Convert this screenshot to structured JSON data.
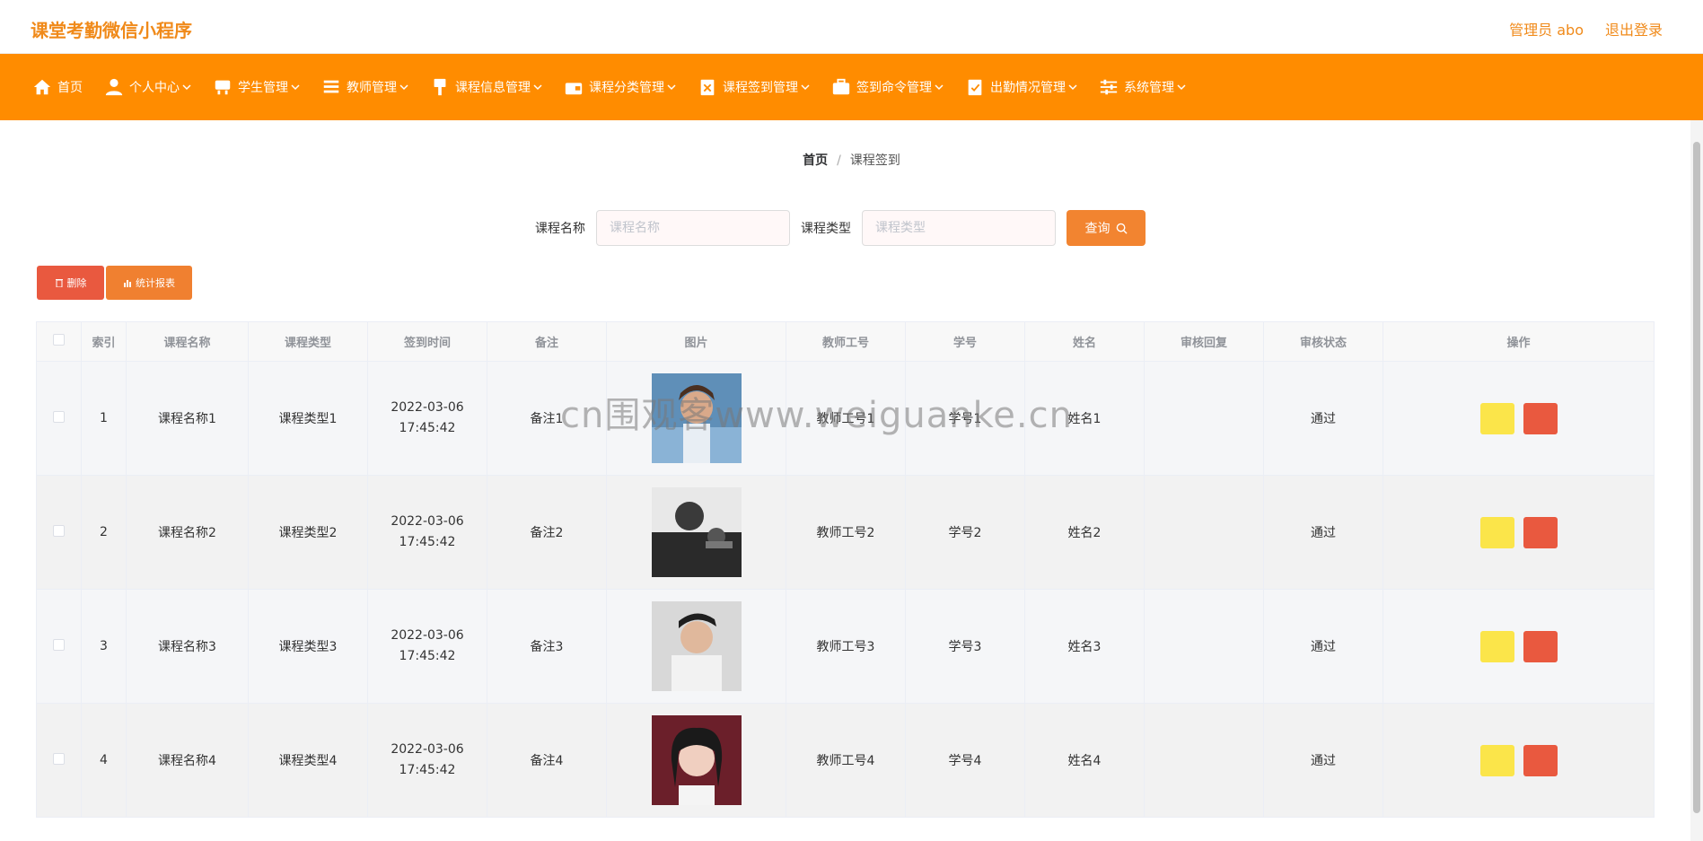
{
  "header": {
    "app_title": "课堂考勤微信小程序",
    "admin_label": "管理员 abo",
    "logout_label": "退出登录"
  },
  "nav": {
    "items": [
      {
        "label": "首页",
        "icon": "home-icon"
      },
      {
        "label": "个人中心",
        "icon": "user-icon"
      },
      {
        "label": "学生管理",
        "icon": "desk-icon"
      },
      {
        "label": "教师管理",
        "icon": "list-icon"
      },
      {
        "label": "课程信息管理",
        "icon": "brush-icon"
      },
      {
        "label": "课程分类管理",
        "icon": "wallet-icon"
      },
      {
        "label": "课程签到管理",
        "icon": "clipboard-x-icon"
      },
      {
        "label": "签到命令管理",
        "icon": "briefcase-icon"
      },
      {
        "label": "出勤情况管理",
        "icon": "clipboard-check-icon"
      },
      {
        "label": "系统管理",
        "icon": "sliders-icon"
      }
    ]
  },
  "breadcrumb": {
    "home": "首页",
    "separator": "/",
    "current": "课程签到"
  },
  "search": {
    "course_name_label": "课程名称",
    "course_name_placeholder": "课程名称",
    "course_type_label": "课程类型",
    "course_type_placeholder": "课程类型",
    "query_label": "查询"
  },
  "actions": {
    "delete_label": "删除",
    "stats_label": "统计报表"
  },
  "table": {
    "headers": [
      "索引",
      "课程名称",
      "课程类型",
      "签到时间",
      "备注",
      "图片",
      "教师工号",
      "学号",
      "姓名",
      "审核回复",
      "审核状态",
      "操作"
    ],
    "rows": [
      {
        "index": "1",
        "course_name": "课程名称1",
        "course_type": "课程类型1",
        "sign_time": "2022-03-06 17:45:42",
        "remark": "备注1",
        "teacher_no": "教师工号1",
        "student_no": "学号1",
        "name": "姓名1",
        "reply": "",
        "status": "通过"
      },
      {
        "index": "2",
        "course_name": "课程名称2",
        "course_type": "课程类型2",
        "sign_time": "2022-03-06 17:45:42",
        "remark": "备注2",
        "teacher_no": "教师工号2",
        "student_no": "学号2",
        "name": "姓名2",
        "reply": "",
        "status": "通过"
      },
      {
        "index": "3",
        "course_name": "课程名称3",
        "course_type": "课程类型3",
        "sign_time": "2022-03-06 17:45:42",
        "remark": "备注3",
        "teacher_no": "教师工号3",
        "student_no": "学号3",
        "name": "姓名3",
        "reply": "",
        "status": "通过"
      },
      {
        "index": "4",
        "course_name": "课程名称4",
        "course_type": "课程类型4",
        "sign_time": "2022-03-06 17:45:42",
        "remark": "备注4",
        "teacher_no": "教师工号4",
        "student_no": "学号4",
        "name": "姓名4",
        "reply": "",
        "status": "通过"
      }
    ]
  },
  "watermark": "cn围观客www.weiguanke.cn",
  "colors": {
    "brand_orange": "#ff8c00",
    "query_button": "#f28430",
    "delete_red": "#e9593f",
    "edit_yellow": "#fbe54a"
  }
}
